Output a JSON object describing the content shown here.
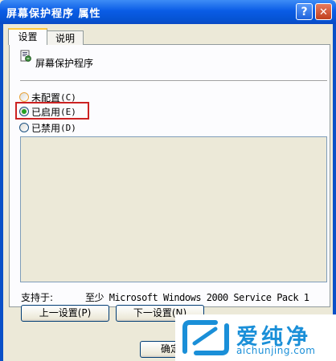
{
  "window": {
    "title": "屏幕保护程序 属性",
    "help_label": "?",
    "close_label": "✕"
  },
  "tabs": [
    {
      "label": "设置",
      "active": true
    },
    {
      "label": "说明",
      "active": false
    }
  ],
  "policy": {
    "title": "屏幕保护程序",
    "icon": "policy-document-icon"
  },
  "options": {
    "not_configured": {
      "label": "未配置",
      "accel": "(C)",
      "checked": false
    },
    "enabled": {
      "label": "已启用",
      "accel": "(E)",
      "checked": true
    },
    "disabled": {
      "label": "已禁用",
      "accel": "(D)",
      "checked": false
    }
  },
  "supported": {
    "label": "支持于:",
    "value": "至少 Microsoft Windows 2000 Service Pack 1"
  },
  "buttons": {
    "prev": "上一设置(P)",
    "next": "下一设置(N)",
    "ok": "确定"
  },
  "watermark": {
    "brand": "爱纯净",
    "url": "aichunjing.com"
  },
  "colors": {
    "title_bar": "#0a5ce6",
    "highlight": "#cc2222",
    "watermark": "#1a8fd8"
  }
}
